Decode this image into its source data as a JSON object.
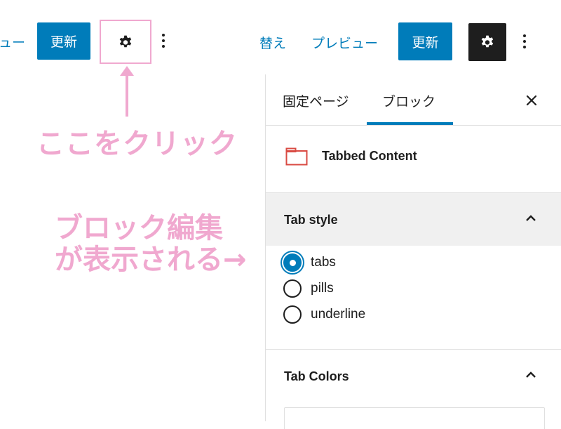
{
  "toolbar_left": {
    "preview_fragment": "ュー",
    "update_label": "更新"
  },
  "toolbar_right": {
    "switch_fragment": "替え",
    "preview_label": "プレビュー",
    "update_label": "更新"
  },
  "annotations": {
    "click_here": "ここをクリック",
    "block_edit_line1": "ブロック編集",
    "block_edit_line2": "が表示される→"
  },
  "sidebar": {
    "tabs": [
      {
        "label": "固定ページ",
        "active": false
      },
      {
        "label": "ブロック",
        "active": true
      }
    ],
    "close_icon": "close-icon",
    "block": {
      "icon": "tabbed-content-block-icon",
      "name": "Tabbed Content"
    },
    "tab_style": {
      "title": "Tab style",
      "expanded": true,
      "options": [
        {
          "label": "tabs",
          "checked": true
        },
        {
          "label": "pills",
          "checked": false
        },
        {
          "label": "underline",
          "checked": false
        }
      ]
    },
    "tab_colors": {
      "title": "Tab Colors",
      "expanded": true
    }
  },
  "colors": {
    "accent": "#007cba",
    "annotation_pink": "#f0a8cf",
    "dark_button": "#1e1e1e",
    "section_header_bg": "#f0f0f0"
  }
}
